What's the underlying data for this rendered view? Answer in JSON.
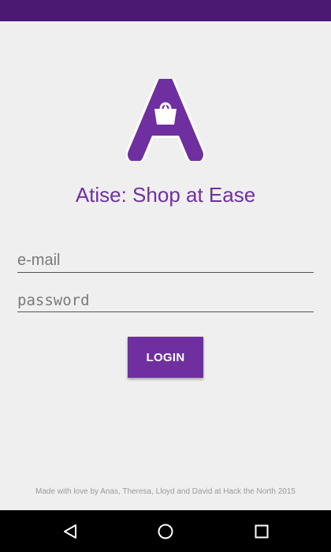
{
  "app": {
    "title": "Atise: Shop at Ease",
    "brand_color": "#6f2fa0",
    "status_bar_color": "#4b1872"
  },
  "form": {
    "email_placeholder": "e-mail",
    "email_value": "",
    "password_placeholder": "password",
    "password_value": "",
    "login_label": "LOGIN"
  },
  "footer": {
    "credits": "Made with love by Anas, Theresa, Lloyd and David at Hack the North 2015"
  },
  "navigation": {
    "icons": [
      "back-icon",
      "home-icon",
      "recents-icon"
    ]
  }
}
